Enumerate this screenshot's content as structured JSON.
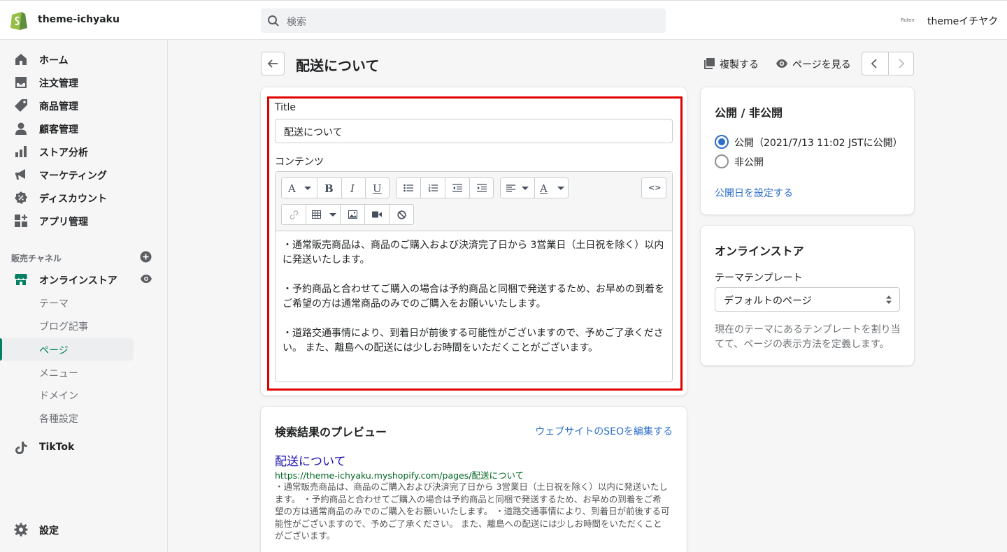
{
  "topbar": {
    "store_name": "theme-ichyaku",
    "search_placeholder": "検索",
    "partner_logo": "Ruten",
    "account_name": "themeイチヤク"
  },
  "sidebar": {
    "items": [
      {
        "label": "ホーム",
        "icon": "home-icon"
      },
      {
        "label": "注文管理",
        "icon": "orders-icon"
      },
      {
        "label": "商品管理",
        "icon": "tag-icon"
      },
      {
        "label": "顧客管理",
        "icon": "customer-icon"
      },
      {
        "label": "ストア分析",
        "icon": "analytics-icon"
      },
      {
        "label": "マーケティング",
        "icon": "megaphone-icon"
      },
      {
        "label": "ディスカウント",
        "icon": "discount-icon"
      },
      {
        "label": "アプリ管理",
        "icon": "apps-icon"
      }
    ],
    "channels_title": "販売チャネル",
    "online_store": "オンラインストア",
    "sub_items": [
      "テーマ",
      "ブログ記事",
      "ページ",
      "メニュー",
      "ドメイン",
      "各種設定"
    ],
    "active_sub": "ページ",
    "tiktok": "TikTok",
    "settings": "設定"
  },
  "header": {
    "title": "配送について",
    "duplicate": "複製する",
    "view_page": "ページを見る"
  },
  "form": {
    "title_label": "Title",
    "title_value": "配送について",
    "content_label": "コンテンツ",
    "paragraphs": [
      "・通常販売商品は、商品のご購入および決済完了日から 3営業日（土日祝を除く）以内に発送いたします。",
      "・予約商品と合わせてご購入の場合は予約商品と同梱で発送するため、お早めの到着をご希望の方は通常商品のみでのご購入をお願いいたします。",
      "・道路交通事情により、到着日が前後する可能性がございますので、予めご了承ください。 また、離島への配送には少しお時間をいただくことがございます。"
    ]
  },
  "seo": {
    "title": "検索結果のプレビュー",
    "edit_link": "ウェブサイトのSEOを編集する",
    "page_title": "配送について",
    "url": "https://theme-ichyaku.myshopify.com/pages/配送について",
    "description": "・通常販売商品は、商品のご購入および決済完了日から 3営業日（土日祝を除く）以内に発送いたします。 ・予約商品と合わせてご購入の場合は予約商品と同梱で発送するため、お早めの到着をご希望の方は通常商品のみでのご購入をお願いいたします。 ・道路交通事情により、到着日が前後する可能性がございますので、予めご了承ください。 また、離島への配送には少しお時間をいただくことがございます。"
  },
  "visibility": {
    "title": "公開 / 非公開",
    "published": "公開（2021/7/13 11:02 JSTに公開）",
    "hidden": "非公開",
    "set_date": "公開日を設定する"
  },
  "online_store_card": {
    "title": "オンラインストア",
    "template_label": "テーマテンプレート",
    "template_value": "デフォルトのページ",
    "help": "現在のテーマにあるテンプレートを割り当てて、ページの表示方法を定義します。"
  },
  "colors": {
    "accent": "#008060",
    "link": "#2c6ecb",
    "highlight": "#e00000"
  }
}
